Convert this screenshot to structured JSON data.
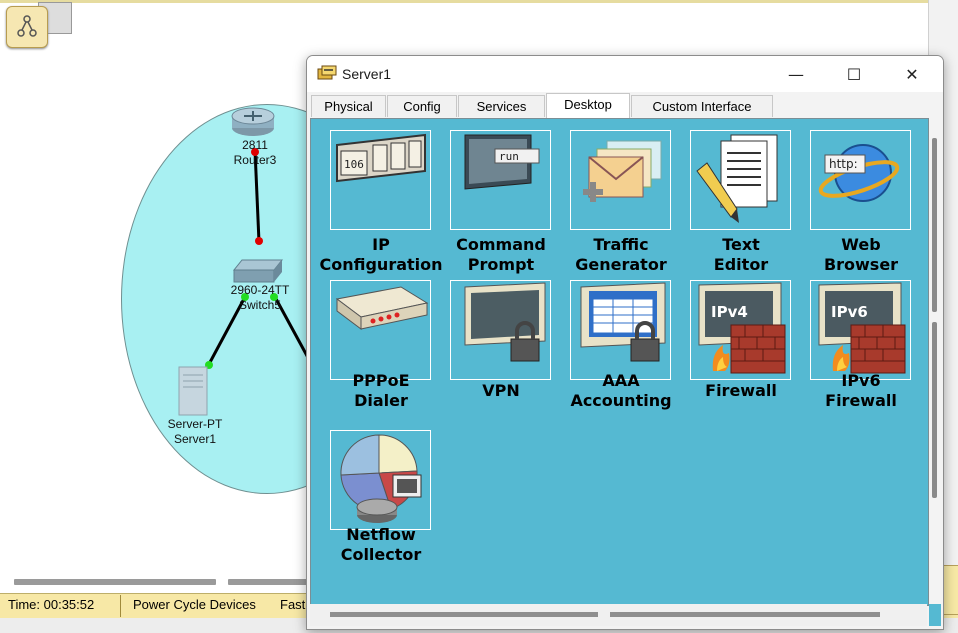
{
  "workspace": {
    "devices": {
      "router": {
        "model": "2811",
        "name": "Router3"
      },
      "switch": {
        "model": "2960-24TT",
        "name": "Switch5"
      },
      "server": {
        "model": "Server-PT",
        "name": "Server1"
      }
    }
  },
  "status_bar": {
    "time": "Time: 00:35:52",
    "power_cycle": "Power Cycle Devices",
    "fast": "Fast"
  },
  "window": {
    "title": "Server1",
    "controls": {
      "minimize": "—",
      "maximize": "☐",
      "close": "✕"
    },
    "tabs": [
      {
        "label": "Physical",
        "active": false
      },
      {
        "label": "Config",
        "active": false
      },
      {
        "label": "Services",
        "active": false
      },
      {
        "label": "Desktop",
        "active": true
      },
      {
        "label": "Custom Interface",
        "active": false
      }
    ],
    "apps": [
      {
        "label": "IP\nConfiguration",
        "icon": "ip-config-icon",
        "icon_text": "106"
      },
      {
        "label": "Command\nPrompt",
        "icon": "command-prompt-icon",
        "icon_text": "run"
      },
      {
        "label": "Traffic\nGenerator",
        "icon": "traffic-generator-icon"
      },
      {
        "label": "Text\nEditor",
        "icon": "text-editor-icon"
      },
      {
        "label": "Web\nBrowser",
        "icon": "web-browser-icon",
        "icon_text": "http:"
      },
      {
        "label": "PPPoE\nDialer",
        "icon": "pppoe-dialer-icon"
      },
      {
        "label": "VPN",
        "icon": "vpn-icon"
      },
      {
        "label": "AAA\nAccounting",
        "icon": "aaa-accounting-icon"
      },
      {
        "label": "Firewall",
        "icon": "firewall-icon",
        "icon_text": "IPv4"
      },
      {
        "label": "IPv6\nFirewall",
        "icon": "ipv6-firewall-icon",
        "icon_text": "IPv6"
      },
      {
        "label": "Netflow\nCollector",
        "icon": "netflow-collector-icon"
      }
    ],
    "colors": {
      "desktop_bg": "#55b9d2",
      "status_bar": "#f7e8a6",
      "cluster": "#a8f0f2"
    }
  }
}
